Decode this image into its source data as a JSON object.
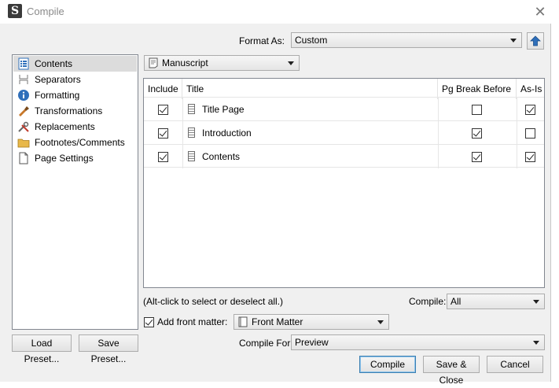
{
  "window": {
    "title": "Compile",
    "close_glyph": "✕"
  },
  "format": {
    "label": "Format As:",
    "value": "Custom"
  },
  "sidebar": {
    "items": [
      {
        "label": "Contents",
        "icon": "list-icon",
        "selected": true
      },
      {
        "label": "Separators",
        "icon": "separator-icon",
        "selected": false
      },
      {
        "label": "Formatting",
        "icon": "info-icon",
        "selected": false
      },
      {
        "label": "Transformations",
        "icon": "brush-icon",
        "selected": false
      },
      {
        "label": "Replacements",
        "icon": "tools-icon",
        "selected": false
      },
      {
        "label": "Footnotes/Comments",
        "icon": "folder-icon",
        "selected": false
      },
      {
        "label": "Page Settings",
        "icon": "page-icon",
        "selected": false
      }
    ]
  },
  "manuscript": {
    "value": "Manuscript"
  },
  "table": {
    "headers": {
      "include": "Include",
      "title": "Title",
      "pgbreak": "Pg Break Before",
      "asis": "As-Is"
    },
    "rows": [
      {
        "title": "Title Page",
        "include": true,
        "pgbreak": false,
        "asis": true
      },
      {
        "title": "Introduction",
        "include": true,
        "pgbreak": true,
        "asis": false
      },
      {
        "title": "Contents",
        "include": true,
        "pgbreak": true,
        "asis": true
      }
    ]
  },
  "hint": "(Alt-click to select or deselect all.)",
  "compile_filter": {
    "label": "Compile:",
    "value": "All"
  },
  "front_matter": {
    "label": "Add front matter:",
    "checked": true,
    "value": "Front Matter"
  },
  "presets": {
    "load": "Load Preset...",
    "save": "Save Preset..."
  },
  "compile_for": {
    "label": "Compile For:",
    "value": "Preview"
  },
  "buttons": {
    "compile": "Compile",
    "save_close": "Save & Close",
    "cancel": "Cancel"
  },
  "colors": {
    "accent_blue": "#2f6fba",
    "selection": "#dcdcdc"
  }
}
